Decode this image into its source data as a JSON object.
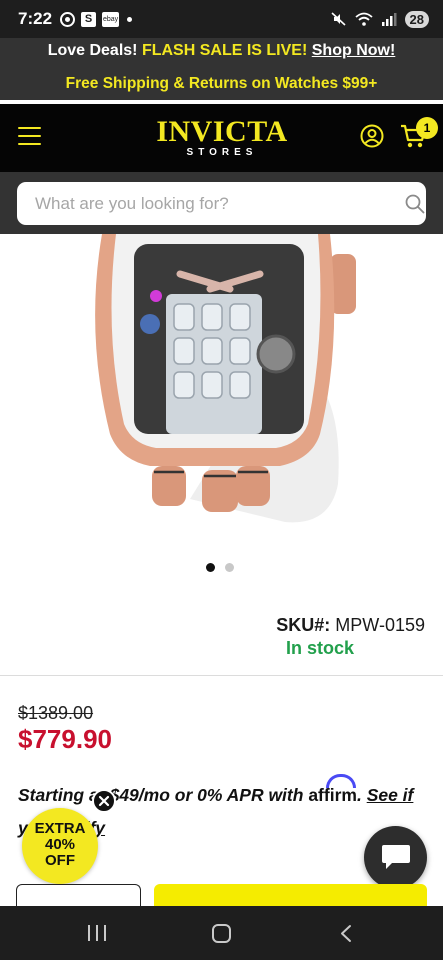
{
  "status_bar": {
    "time": "7:22",
    "s_app": "S",
    "ebay_app": "ebay",
    "battery": "28",
    "icons": [
      "target-icon",
      "s-app-icon",
      "ebay-icon",
      "dot-icon",
      "mute-icon",
      "wifi-icon",
      "signal-icon",
      "battery-icon"
    ]
  },
  "promo": {
    "love_deals": "Love Deals!",
    "flash_sale": "FLASH SALE IS LIVE!",
    "shop_now": "Shop Now!",
    "shipping": "Free Shipping & Returns on Watches $99+"
  },
  "header": {
    "logo_main": "INVICTA",
    "logo_sub": "STORES",
    "cart_count": "1",
    "icons": [
      "hamburger-menu-icon",
      "account-icon",
      "cart-icon"
    ]
  },
  "search": {
    "placeholder": "What are you looking for?"
  },
  "product": {
    "image_alt": "Rose gold skeleton watch with white strap",
    "carousel_count": 2,
    "carousel_active": 1,
    "sku_label": "SKU#:",
    "sku_value": "MPW-0159",
    "stock_status": "In stock",
    "old_price": "$1389.00",
    "new_price": "$779.90"
  },
  "financing": {
    "starting": "Starting a",
    "amount": "$49/mo or 0% APR with",
    "brand": "affirm",
    "brand_dot": ".",
    "see_if": "See if",
    "line2": "y",
    "line2_end": "ify"
  },
  "badge": {
    "line1": "EXTRA",
    "line2": "40%",
    "line3": "OFF"
  },
  "colors": {
    "accent_yellow": "#f3e821",
    "price_red": "#c8102e",
    "stock_green": "#22a04c",
    "header_black": "#050505",
    "banner_gray": "#333333"
  }
}
